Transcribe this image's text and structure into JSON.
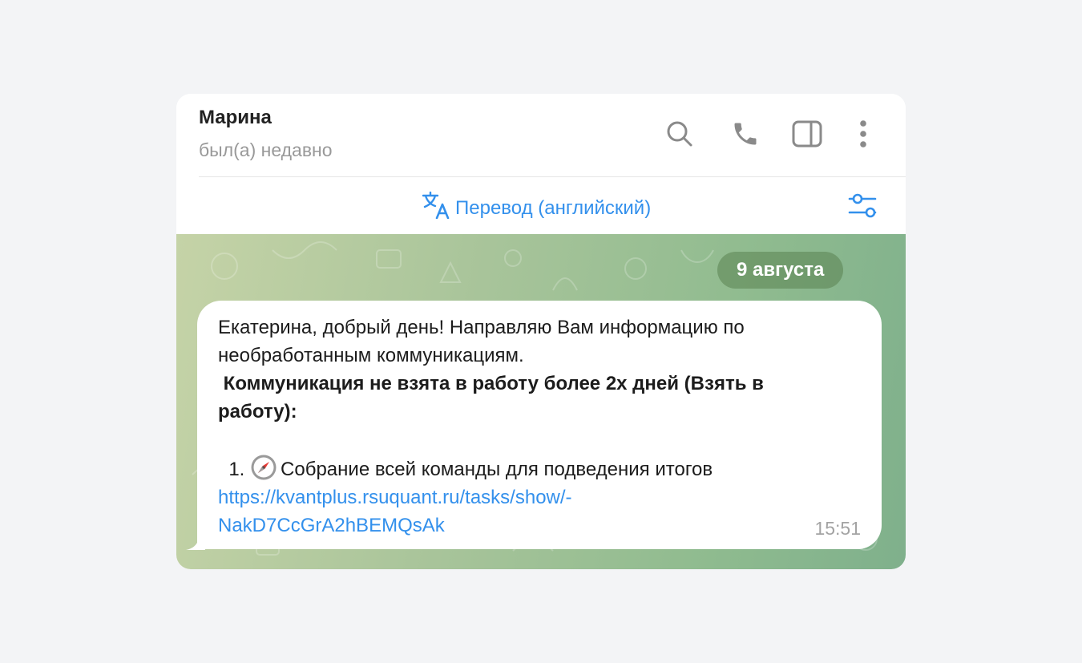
{
  "header": {
    "contact_name": "Марина",
    "contact_status": "был(а) недавно",
    "icons": [
      "search-icon",
      "phone-icon",
      "sidebar-toggle-icon",
      "more-vertical-icon"
    ]
  },
  "translate_bar": {
    "label": "Перевод (английский)",
    "icon": "translate-icon",
    "settings_icon": "settings-sliders-icon"
  },
  "chat": {
    "date": "9 августа",
    "message": {
      "line1": "Екатерина, добрый день! Направляю Вам информацию по",
      "line2": "необработанным коммуникациям.",
      "bold_line1": " Коммуникация не взята в работу более 2х дней (Взять в",
      "bold_line2": "работу):",
      "item_number": "  1. ",
      "item_icon": "compass-icon",
      "item_text": "Собрание всей команды для подведения итогов",
      "link_line1": "https://kvantplus.rsuquant.ru/tasks/show/-",
      "link_line2": "NakD7CcGrA2hBEMQsAk",
      "time": "15:51"
    }
  },
  "colors": {
    "accent": "#3390ec",
    "page_background": "#f3f4f6",
    "chat_background_start": "#c5d3a7",
    "chat_background_end": "#7fb08c"
  }
}
